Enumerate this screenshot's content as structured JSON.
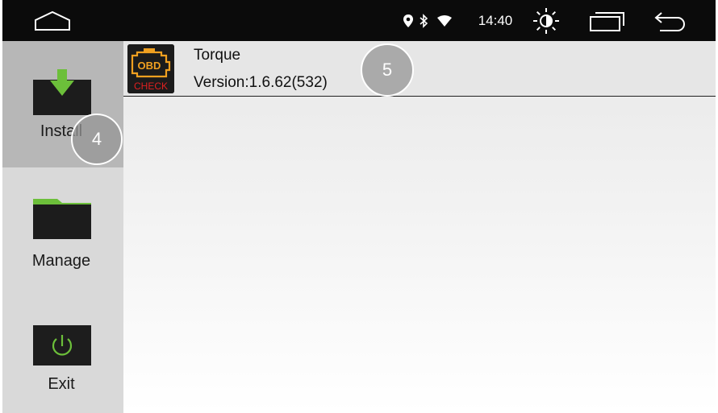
{
  "status_bar": {
    "time": "14:40",
    "icons": [
      "home-icon",
      "location-icon",
      "bluetooth-icon",
      "wifi-icon",
      "brightness-icon",
      "recent-apps-icon",
      "back-icon"
    ]
  },
  "sidebar": {
    "items": [
      {
        "label": "Install",
        "icon": "download-icon",
        "selected": true
      },
      {
        "label": "Manage",
        "icon": "folder-icon",
        "selected": false
      },
      {
        "label": "Exit",
        "icon": "power-icon",
        "selected": false
      }
    ]
  },
  "apps": [
    {
      "name": "Torque",
      "version": "Version:1.6.62(532)",
      "icon": "obd-check-icon",
      "icon_text_top": "OBD",
      "icon_text_bottom": "CHECK"
    }
  ],
  "markers": [
    "4",
    "5"
  ],
  "colors": {
    "statusbar": "#0b0b0b",
    "accent_green": "#6cbf3a",
    "sidebar": "#d9d9d9",
    "sidebar_selected": "#b7b7b7",
    "obd_orange": "#f0a020",
    "obd_red": "#e02020"
  }
}
